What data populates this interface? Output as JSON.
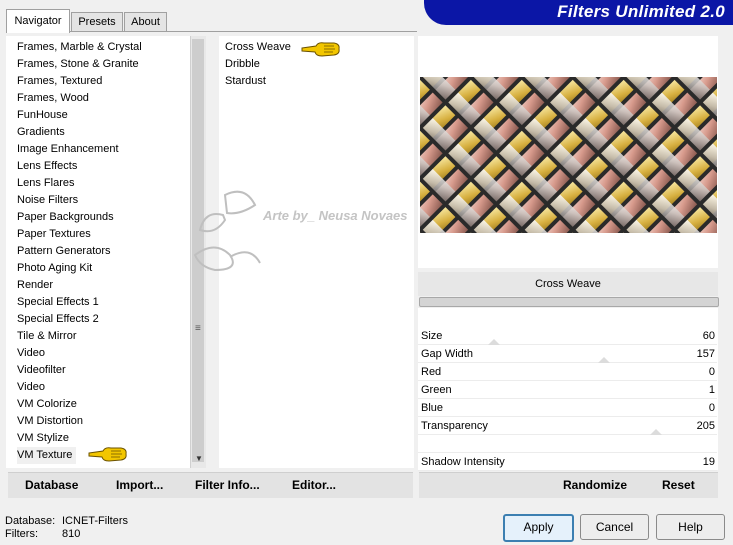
{
  "tabs": [
    "Navigator",
    "Presets",
    "About"
  ],
  "banner_title": "Filters Unlimited 2.0",
  "categories": [
    "Frames, Marble & Crystal",
    "Frames, Stone & Granite",
    "Frames, Textured",
    "Frames, Wood",
    "FunHouse",
    "Gradients",
    "Image Enhancement",
    "Lens Effects",
    "Lens Flares",
    "Noise Filters",
    "Paper Backgrounds",
    "Paper Textures",
    "Pattern Generators",
    "Photo Aging Kit",
    "Render",
    "Special Effects 1",
    "Special Effects 2",
    "Tile & Mirror",
    "Video",
    "Videofilter",
    "Video",
    "VM Colorize",
    "VM Distortion",
    "VM Stylize",
    "VM Texture"
  ],
  "selected_category": "VM Texture",
  "filters": [
    "Cross Weave",
    "Dribble",
    "Stardust"
  ],
  "selected_filter": "Cross Weave",
  "watermark_text": "Arte by_ Neusa Novaes",
  "filter_name_display": "Cross Weave",
  "params": [
    {
      "label": "Size",
      "value": "60",
      "level": 0.24
    },
    {
      "label": "Gap Width",
      "value": "157",
      "level": 0.62
    },
    {
      "label": "Red",
      "value": "0",
      "level": null
    },
    {
      "label": "Green",
      "value": "1",
      "level": null
    },
    {
      "label": "Blue",
      "value": "0",
      "level": null
    },
    {
      "label": "Transparency",
      "value": "205",
      "level": 0.8
    },
    {
      "label": "",
      "value": "",
      "level": null
    },
    {
      "label": "Shadow Intensity",
      "value": "19",
      "level": null
    }
  ],
  "toolbar": {
    "database": "Database",
    "import": "Import...",
    "filter_info": "Filter Info...",
    "editor": "Editor...",
    "randomize": "Randomize",
    "reset": "Reset"
  },
  "status": {
    "database_label": "Database:",
    "database_value": "ICNET-Filters",
    "filters_label": "Filters:",
    "filters_value": "810"
  },
  "buttons": {
    "apply": "Apply",
    "cancel": "Cancel",
    "help": "Help"
  },
  "colors": {
    "banner": "#0b16a6",
    "pointer": "#f2c600",
    "primary_border": "#3c7fb1"
  }
}
